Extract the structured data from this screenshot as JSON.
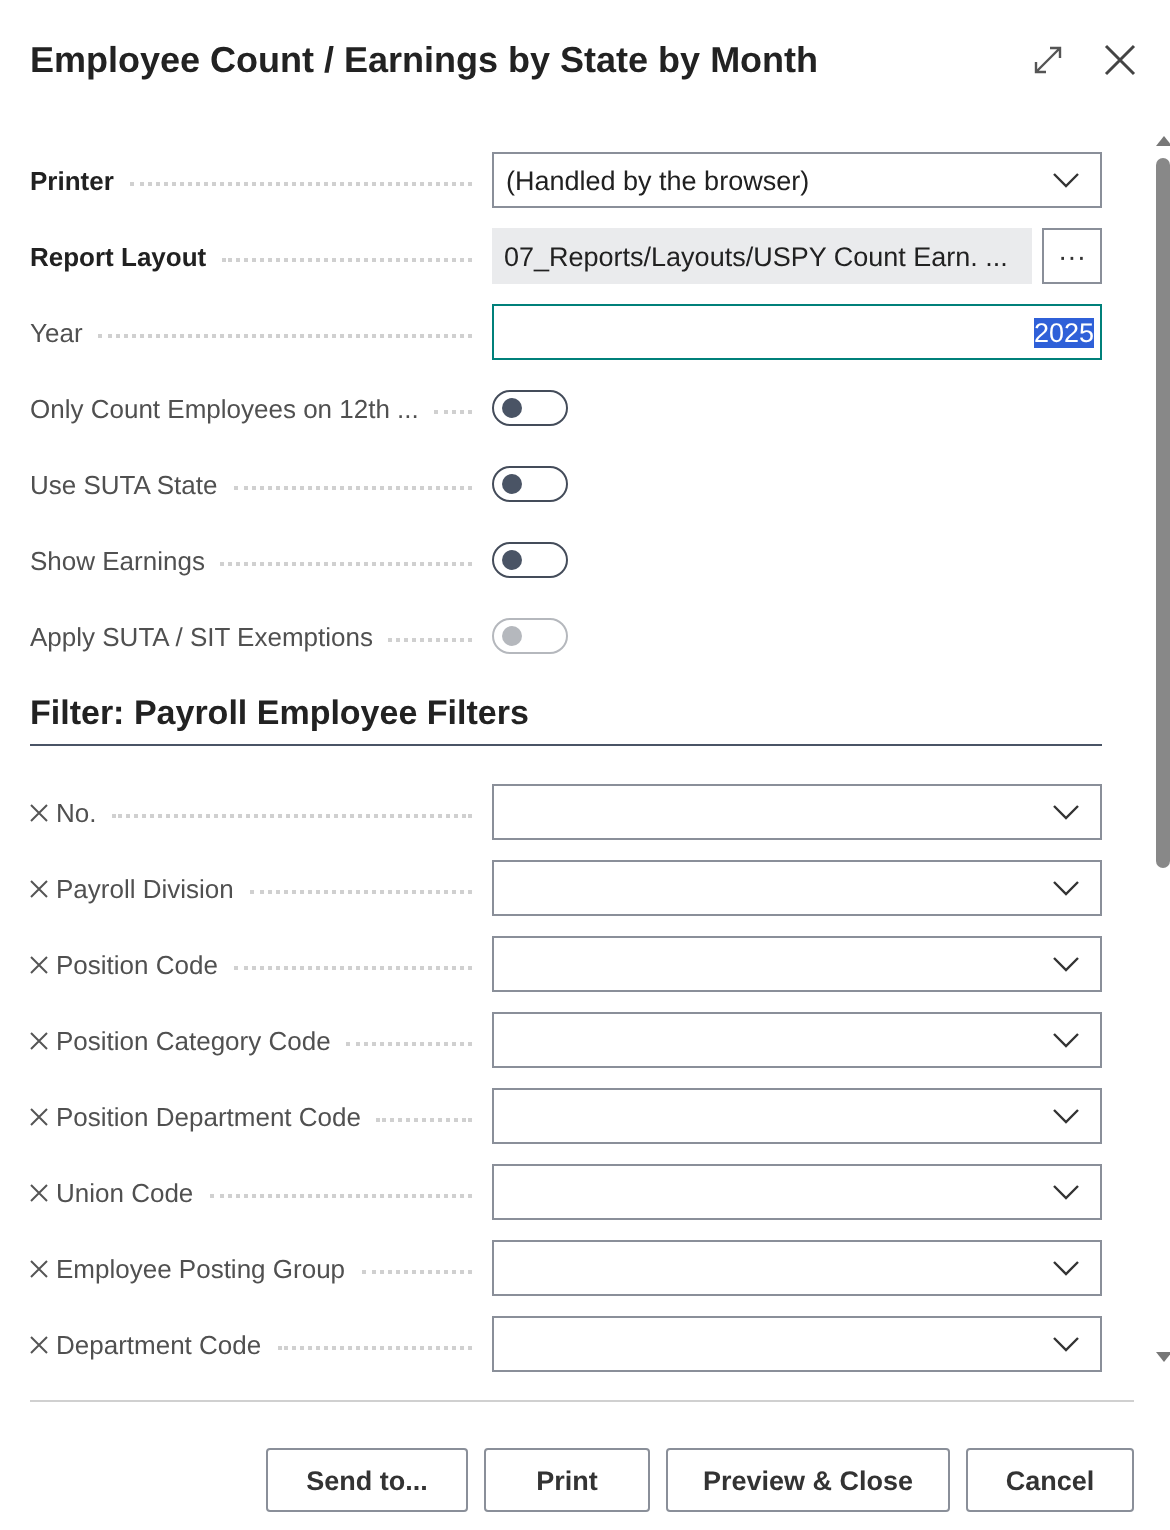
{
  "window": {
    "title": "Employee Count / Earnings by State by Month"
  },
  "options": [
    {
      "kind": "dropdown",
      "label": "Printer",
      "bold": true,
      "value": "(Handled by the browser)"
    },
    {
      "kind": "layout",
      "label": "Report Layout",
      "bold": true,
      "value": "07_Reports/Layouts/USPY Count  Earn. ...",
      "button": "···"
    },
    {
      "kind": "number",
      "label": "Year",
      "bold": false,
      "value": "2025",
      "focused": true
    },
    {
      "kind": "toggle",
      "label": "Only Count Employees on 12th ...",
      "bold": false,
      "on": false,
      "disabled": false
    },
    {
      "kind": "toggle",
      "label": "Use SUTA State",
      "bold": false,
      "on": false,
      "disabled": false
    },
    {
      "kind": "toggle",
      "label": "Show Earnings",
      "bold": false,
      "on": false,
      "disabled": false
    },
    {
      "kind": "toggle",
      "label": "Apply SUTA / SIT Exemptions",
      "bold": false,
      "on": false,
      "disabled": true
    }
  ],
  "filter_section": {
    "title": "Filter: Payroll Employee Filters",
    "filters": [
      {
        "label": "No."
      },
      {
        "label": "Payroll Division"
      },
      {
        "label": "Position Code"
      },
      {
        "label": "Position Category Code"
      },
      {
        "label": "Position Department Code"
      },
      {
        "label": "Union Code"
      },
      {
        "label": "Employee Posting Group"
      },
      {
        "label": "Department Code"
      }
    ]
  },
  "buttons": [
    "Send to...",
    "Print",
    "Preview & Close",
    "Cancel"
  ]
}
